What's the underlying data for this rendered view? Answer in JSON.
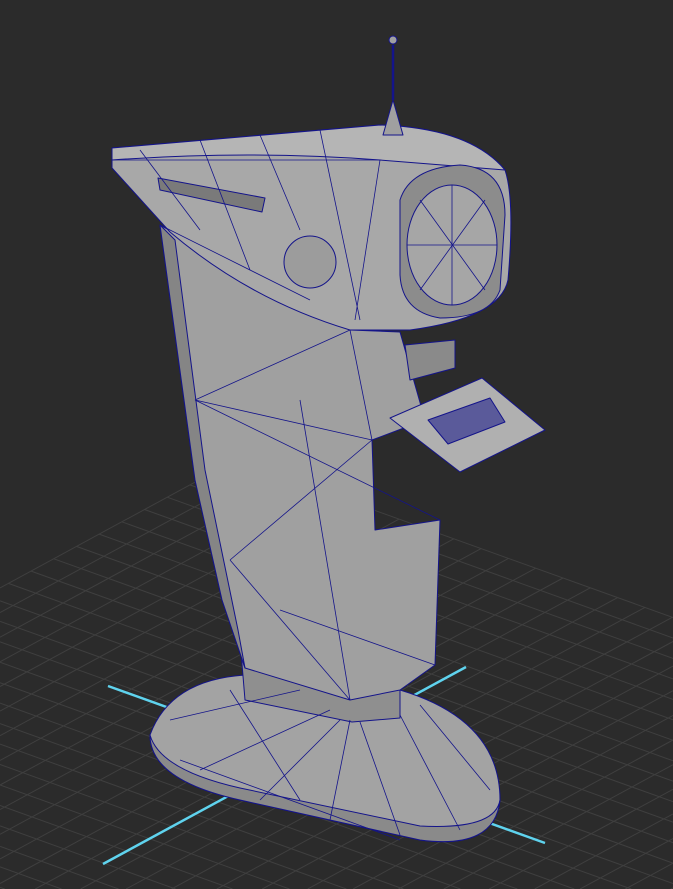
{
  "viewport": {
    "background_color": "#2b2b2b",
    "grid_color": "#3f3f3f",
    "axis_color": "#5fd3ee",
    "model_fill": "#9a9a9a",
    "model_shade": "#7c7c7c",
    "wireframe_color": "#14148a"
  }
}
